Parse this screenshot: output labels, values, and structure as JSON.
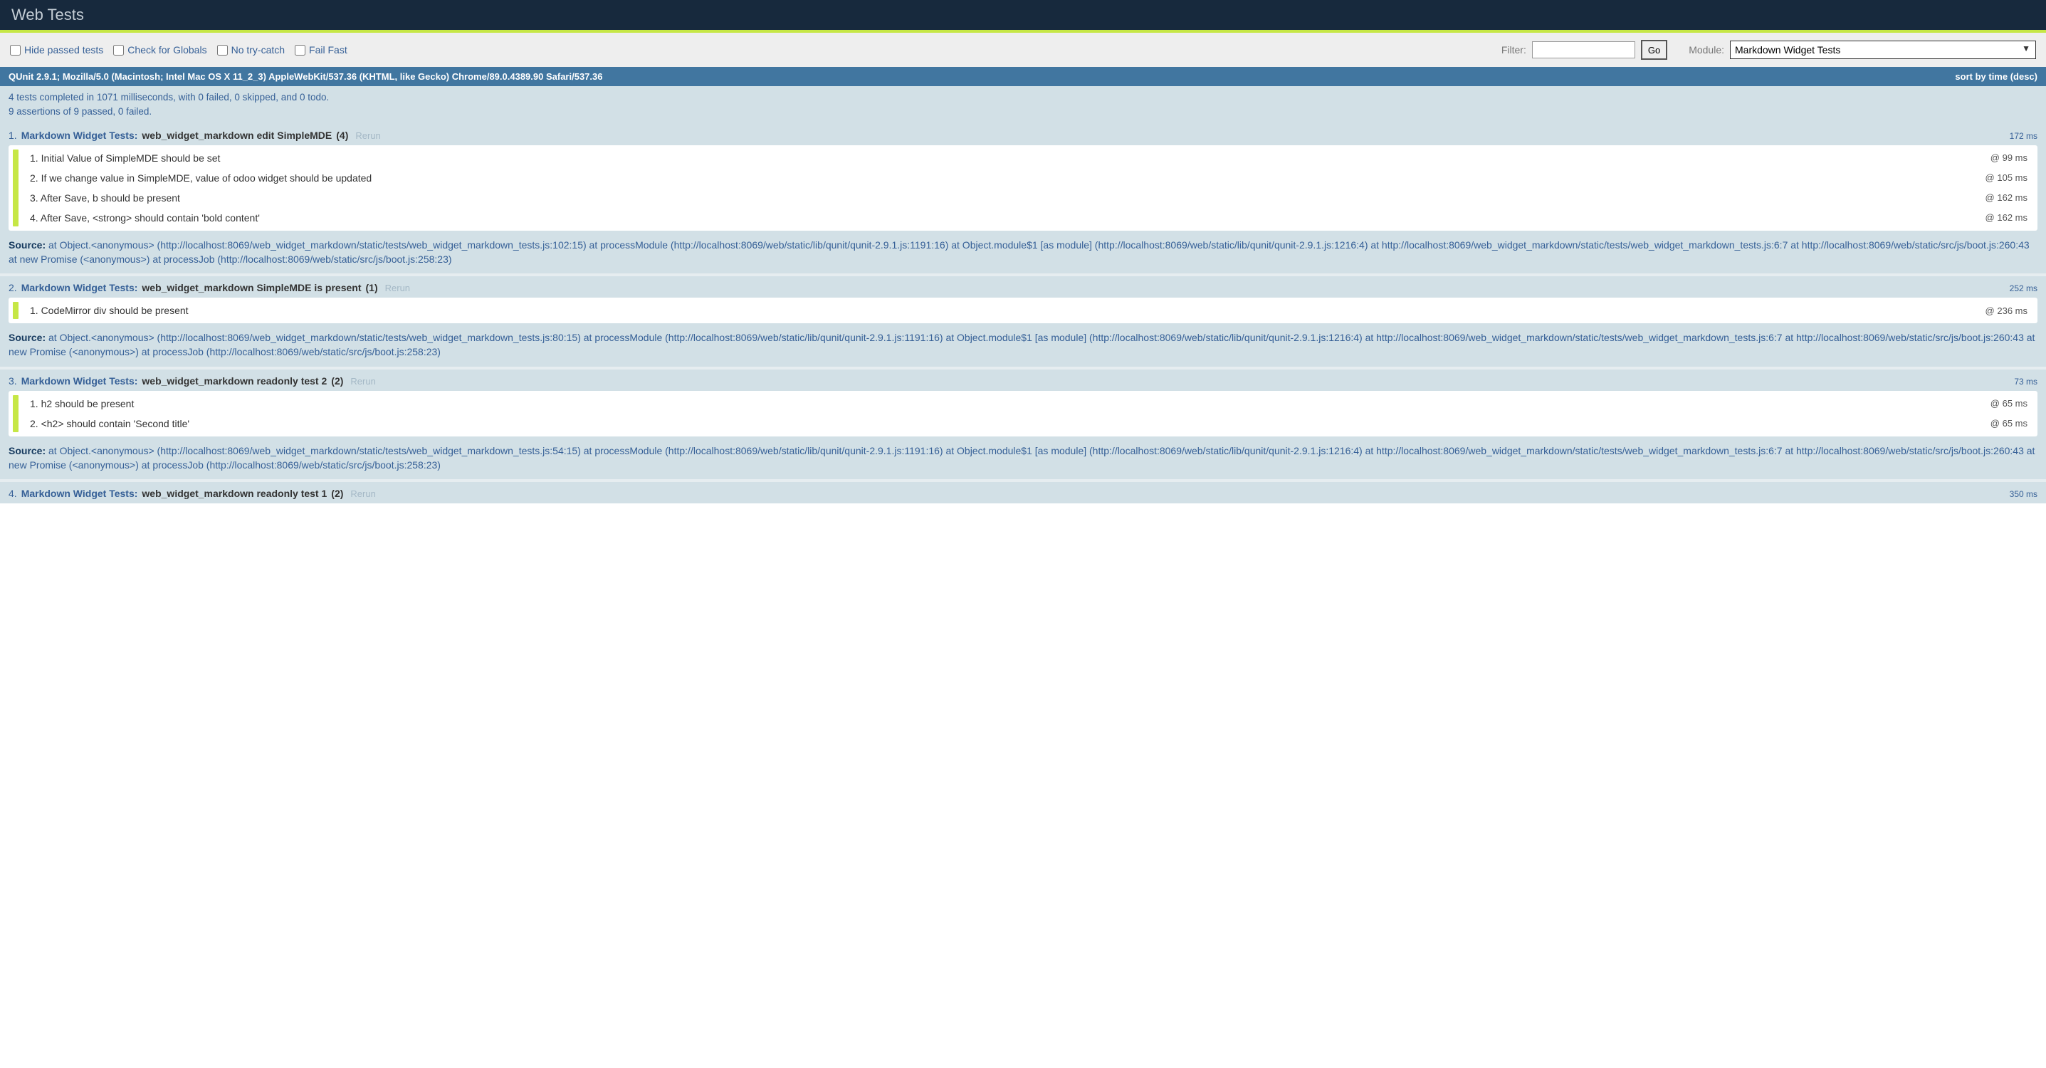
{
  "header": {
    "title": "Web Tests"
  },
  "toolbar": {
    "hide_passed": "Hide passed tests",
    "check_globals": "Check for Globals",
    "no_trycatch": "No try-catch",
    "fail_fast": "Fail Fast",
    "filter_label": "Filter:",
    "go_label": "Go",
    "module_label": "Module:",
    "module_selected": "Markdown Widget Tests"
  },
  "userAgent": {
    "text": "QUnit 2.9.1; Mozilla/5.0 (Macintosh; Intel Mac OS X 11_2_3) AppleWebKit/537.36 (KHTML, like Gecko) Chrome/89.0.4389.90 Safari/537.36",
    "sort": "sort by time (desc)"
  },
  "summary": {
    "line1": "4 tests completed in 1071 milliseconds, with 0 failed, 0 skipped, and 0 todo.",
    "line2": "9 assertions of 9 passed, 0 failed."
  },
  "rerun_label": "Rerun",
  "source_label": "Source:",
  "tests": [
    {
      "num": "1.",
      "module": "Markdown Widget Tests:",
      "name": "web_widget_markdown edit SimpleMDE",
      "count": "(4)",
      "runtime": "172 ms",
      "asserts": [
        {
          "text": "1. Initial Value of SimpleMDE should be set",
          "at": "@ 99 ms"
        },
        {
          "text": "2. If we change value in SimpleMDE, value of odoo widget should be updated",
          "at": "@ 105 ms"
        },
        {
          "text": "3. After Save, b should be present",
          "at": "@ 162 ms"
        },
        {
          "text": "4. After Save, <strong> should contain 'bold content'",
          "at": "@ 162 ms"
        }
      ],
      "source": "at Object.<anonymous> (http://localhost:8069/web_widget_markdown/static/tests/web_widget_markdown_tests.js:102:15) at processModule (http://localhost:8069/web/static/lib/qunit/qunit-2.9.1.js:1191:16) at Object.module$1 [as module] (http://localhost:8069/web/static/lib/qunit/qunit-2.9.1.js:1216:4) at http://localhost:8069/web_widget_markdown/static/tests/web_widget_markdown_tests.js:6:7 at http://localhost:8069/web/static/src/js/boot.js:260:43 at new Promise (<anonymous>) at processJob (http://localhost:8069/web/static/src/js/boot.js:258:23)"
    },
    {
      "num": "2.",
      "module": "Markdown Widget Tests:",
      "name": "web_widget_markdown SimpleMDE is present",
      "count": "(1)",
      "runtime": "252 ms",
      "asserts": [
        {
          "text": "1. CodeMirror div should be present",
          "at": "@ 236 ms"
        }
      ],
      "source": "at Object.<anonymous> (http://localhost:8069/web_widget_markdown/static/tests/web_widget_markdown_tests.js:80:15) at processModule (http://localhost:8069/web/static/lib/qunit/qunit-2.9.1.js:1191:16) at Object.module$1 [as module] (http://localhost:8069/web/static/lib/qunit/qunit-2.9.1.js:1216:4) at http://localhost:8069/web_widget_markdown/static/tests/web_widget_markdown_tests.js:6:7 at http://localhost:8069/web/static/src/js/boot.js:260:43 at new Promise (<anonymous>) at processJob (http://localhost:8069/web/static/src/js/boot.js:258:23)"
    },
    {
      "num": "3.",
      "module": "Markdown Widget Tests:",
      "name": "web_widget_markdown readonly test 2",
      "count": "(2)",
      "runtime": "73 ms",
      "asserts": [
        {
          "text": "1. h2 should be present",
          "at": "@ 65 ms"
        },
        {
          "text": "2. <h2> should contain 'Second title'",
          "at": "@ 65 ms"
        }
      ],
      "source": "at Object.<anonymous> (http://localhost:8069/web_widget_markdown/static/tests/web_widget_markdown_tests.js:54:15) at processModule (http://localhost:8069/web/static/lib/qunit/qunit-2.9.1.js:1191:16) at Object.module$1 [as module] (http://localhost:8069/web/static/lib/qunit/qunit-2.9.1.js:1216:4) at http://localhost:8069/web_widget_markdown/static/tests/web_widget_markdown_tests.js:6:7 at http://localhost:8069/web/static/src/js/boot.js:260:43 at new Promise (<anonymous>) at processJob (http://localhost:8069/web/static/src/js/boot.js:258:23)"
    },
    {
      "num": "4.",
      "module": "Markdown Widget Tests:",
      "name": "web_widget_markdown readonly test 1",
      "count": "(2)",
      "runtime": "350 ms",
      "asserts": [],
      "source": ""
    }
  ]
}
